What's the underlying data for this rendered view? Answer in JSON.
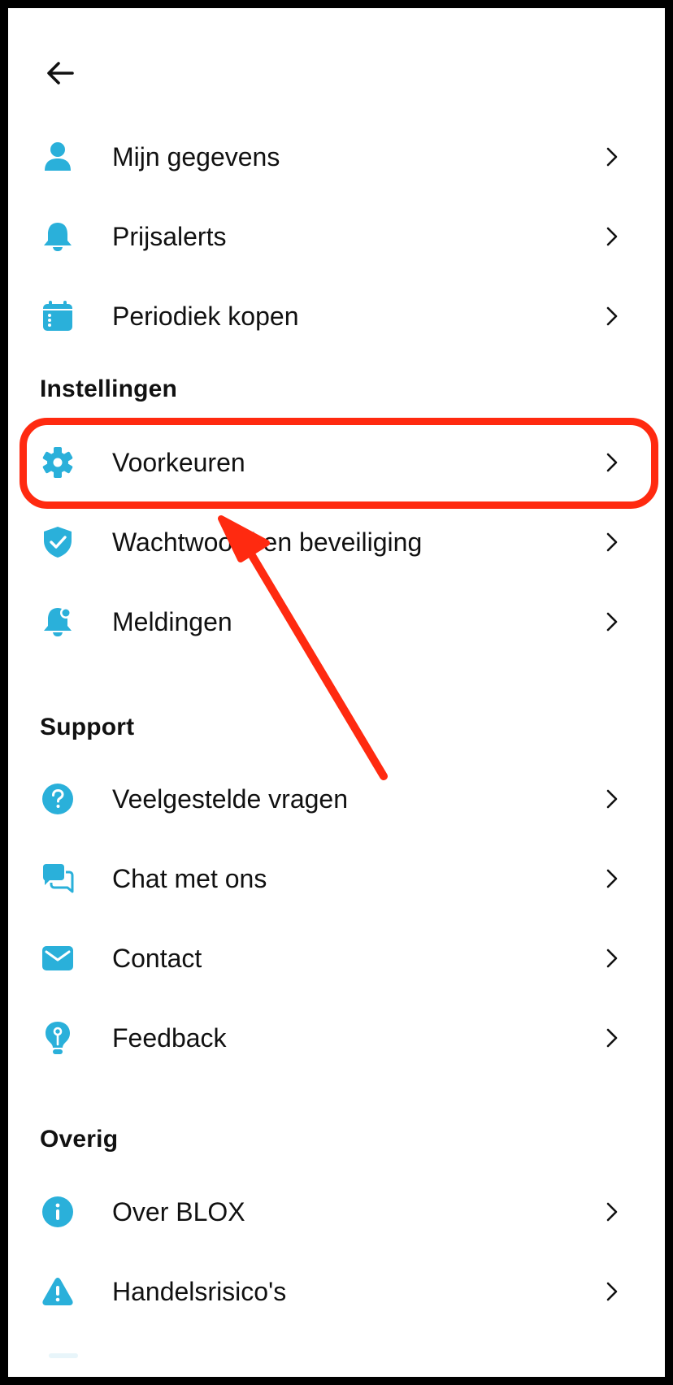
{
  "colors": {
    "accent": "#2ab0da",
    "highlight": "#ff2a10",
    "text": "#111111"
  },
  "header": {
    "back_icon": "arrow-left-icon"
  },
  "account": [
    {
      "label": "Mijn gegevens",
      "icon": "person-icon"
    },
    {
      "label": "Prijsalerts",
      "icon": "bell-icon"
    },
    {
      "label": "Periodiek kopen",
      "icon": "calendar-icon"
    }
  ],
  "instellingen": {
    "title": "Instellingen",
    "items": [
      {
        "label": "Voorkeuren",
        "icon": "gear-icon"
      },
      {
        "label": "Wachtwoord en beveiliging",
        "icon": "shield-check-icon"
      },
      {
        "label": "Meldingen",
        "icon": "notification-bell-icon"
      }
    ]
  },
  "support": {
    "title": "Support",
    "items": [
      {
        "label": "Veelgestelde vragen",
        "icon": "question-icon"
      },
      {
        "label": "Chat met ons",
        "icon": "chat-icon"
      },
      {
        "label": "Contact",
        "icon": "mail-icon"
      },
      {
        "label": "Feedback",
        "icon": "lightbulb-icon"
      }
    ]
  },
  "overig": {
    "title": "Overig",
    "items": [
      {
        "label": "Over BLOX",
        "icon": "info-icon"
      },
      {
        "label": "Handelsrisico's",
        "icon": "warning-icon"
      }
    ]
  }
}
